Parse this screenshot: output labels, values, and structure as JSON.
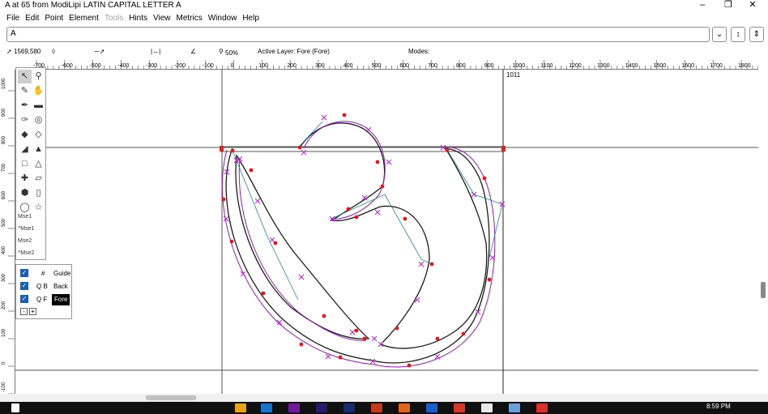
{
  "window": {
    "title": "A at 65 from ModiLipi LATIN CAPITAL LETTER A",
    "minimize": "–",
    "restore": "❐",
    "close": "✕"
  },
  "menu": [
    "File",
    "Edit",
    "Point",
    "Element",
    "Tools",
    "Hints",
    "View",
    "Metrics",
    "Window",
    "Help"
  ],
  "menu_disabled": [
    "Tools"
  ],
  "glyph_field": {
    "value": "A",
    "btn_down": "⌄",
    "btn_up": "↕",
    "btn_updown": "⇕"
  },
  "infobar": {
    "coords": "1569,580",
    "zoom": "50%",
    "active_layer": "Active Layer: Fore (Fore)",
    "modes": "Modes:"
  },
  "ruler": {
    "h_labels": [
      "-700",
      "-600",
      "-500",
      "-400",
      "-300",
      "-200",
      "-100",
      "0",
      "100",
      "200",
      "300",
      "400",
      "500",
      "600",
      "700",
      "800",
      "900",
      "1000",
      "1100",
      "1200",
      "1300",
      "1400",
      "1500",
      "1600",
      "1700",
      "1800"
    ],
    "v_labels": [
      "1000",
      "900",
      "800",
      "700",
      "600",
      "500",
      "400",
      "300",
      "200",
      "100",
      "0",
      "-100"
    ]
  },
  "canvas": {
    "width_label": "1011"
  },
  "tools": {
    "mse_labels": [
      "Mse1",
      "^Mse1",
      "Mse2",
      "^Mse2"
    ]
  },
  "layers": [
    {
      "mark": "#",
      "name": "Guide",
      "active": false
    },
    {
      "mark": "Q  B",
      "name": "Back",
      "active": false
    },
    {
      "mark": "Q  F",
      "name": "Fore",
      "active": true
    }
  ],
  "layer_controls": {
    "minus": "-",
    "plus": "+"
  },
  "taskbar": {
    "time": "8:59 PM"
  },
  "colors": {
    "outline": "#1c1c1c",
    "spline": "#9a1ac0",
    "point": "#e3171b",
    "control": "#c020d8",
    "accent": "#1a5fb4"
  }
}
